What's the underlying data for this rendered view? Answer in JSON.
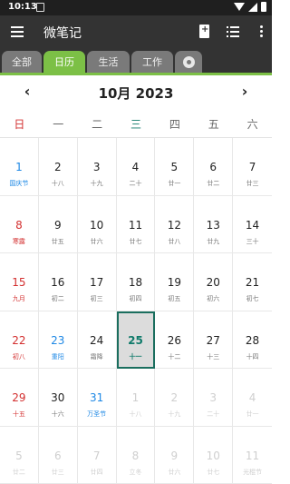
{
  "status": {
    "time": "10:13"
  },
  "app": {
    "title": "微笔记"
  },
  "tabs": [
    {
      "label": "全部"
    },
    {
      "label": "日历"
    },
    {
      "label": "生活"
    },
    {
      "label": "工作"
    }
  ],
  "calendar": {
    "month_title": "10月 2023",
    "prev_label": "‹",
    "next_label": "›",
    "weekdays": [
      "日",
      "一",
      "二",
      "三",
      "四",
      "五",
      "六"
    ],
    "days": [
      {
        "day": "1",
        "lunar": "国庆节",
        "type": "holiday"
      },
      {
        "day": "2",
        "lunar": "十八",
        "type": "normal"
      },
      {
        "day": "3",
        "lunar": "十九",
        "type": "normal"
      },
      {
        "day": "4",
        "lunar": "二十",
        "type": "normal"
      },
      {
        "day": "5",
        "lunar": "廿一",
        "type": "normal"
      },
      {
        "day": "6",
        "lunar": "廿二",
        "type": "normal"
      },
      {
        "day": "7",
        "lunar": "廿三",
        "type": "normal"
      },
      {
        "day": "8",
        "lunar": "寒露",
        "type": "sun"
      },
      {
        "day": "9",
        "lunar": "廿五",
        "type": "normal"
      },
      {
        "day": "10",
        "lunar": "廿六",
        "type": "normal"
      },
      {
        "day": "11",
        "lunar": "廿七",
        "type": "normal"
      },
      {
        "day": "12",
        "lunar": "廿八",
        "type": "normal"
      },
      {
        "day": "13",
        "lunar": "廿九",
        "type": "normal"
      },
      {
        "day": "14",
        "lunar": "三十",
        "type": "normal"
      },
      {
        "day": "15",
        "lunar": "九月",
        "type": "sun"
      },
      {
        "day": "16",
        "lunar": "初二",
        "type": "normal"
      },
      {
        "day": "17",
        "lunar": "初三",
        "type": "normal"
      },
      {
        "day": "18",
        "lunar": "初四",
        "type": "normal"
      },
      {
        "day": "19",
        "lunar": "初五",
        "type": "normal"
      },
      {
        "day": "20",
        "lunar": "初六",
        "type": "normal"
      },
      {
        "day": "21",
        "lunar": "初七",
        "type": "normal"
      },
      {
        "day": "22",
        "lunar": "初八",
        "type": "sun"
      },
      {
        "day": "23",
        "lunar": "重阳",
        "type": "holiday"
      },
      {
        "day": "24",
        "lunar": "霜降",
        "type": "normal"
      },
      {
        "day": "25",
        "lunar": "十一",
        "type": "today"
      },
      {
        "day": "26",
        "lunar": "十二",
        "type": "normal"
      },
      {
        "day": "27",
        "lunar": "十三",
        "type": "normal"
      },
      {
        "day": "28",
        "lunar": "十四",
        "type": "normal"
      },
      {
        "day": "29",
        "lunar": "十五",
        "type": "sun"
      },
      {
        "day": "30",
        "lunar": "十六",
        "type": "normal"
      },
      {
        "day": "31",
        "lunar": "万圣节",
        "type": "holiday"
      },
      {
        "day": "1",
        "lunar": "十八",
        "type": "other"
      },
      {
        "day": "2",
        "lunar": "十九",
        "type": "other"
      },
      {
        "day": "3",
        "lunar": "二十",
        "type": "other"
      },
      {
        "day": "4",
        "lunar": "廿一",
        "type": "other"
      },
      {
        "day": "5",
        "lunar": "廿二",
        "type": "other"
      },
      {
        "day": "6",
        "lunar": "廿三",
        "type": "other"
      },
      {
        "day": "7",
        "lunar": "廿四",
        "type": "other"
      },
      {
        "day": "8",
        "lunar": "立冬",
        "type": "other"
      },
      {
        "day": "9",
        "lunar": "廿六",
        "type": "other"
      },
      {
        "day": "10",
        "lunar": "廿七",
        "type": "other"
      },
      {
        "day": "11",
        "lunar": "光棍节",
        "type": "other"
      }
    ]
  },
  "icons": {
    "menu": "hamburger-icon",
    "new_note": "new-note-icon",
    "list": "list-view-icon",
    "more": "more-vert-icon",
    "settings": "gear-icon"
  },
  "colors": {
    "accent": "#7cc046",
    "today": "#0f7a6a",
    "sunday": "#d32f2f",
    "holiday": "#1e88e5"
  }
}
